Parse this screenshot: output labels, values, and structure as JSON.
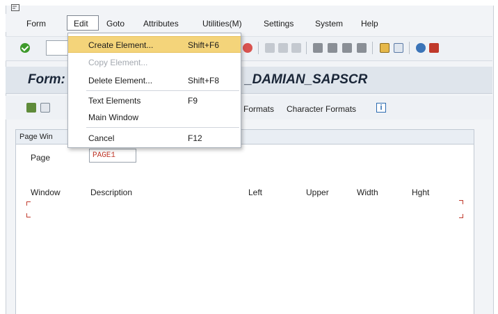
{
  "menubar": {
    "items": [
      "Form",
      "Edit",
      "Goto",
      "Attributes",
      "Utilities(M)",
      "Settings",
      "System",
      "Help"
    ]
  },
  "title": {
    "left": "Form:",
    "right": "_DAMIAN_SAPSCR"
  },
  "app_toolbar": {
    "formats": "Formats",
    "character_formats": "Character Formats"
  },
  "panel": {
    "title": "Page Win",
    "page_label": "Page",
    "page_value": "PAGE1",
    "columns": [
      "Window",
      "Description",
      "Left",
      "Upper",
      "Width",
      "Hght"
    ]
  },
  "dropdown": {
    "items": [
      {
        "label": "Create Element...",
        "shortcut": "Shift+F6",
        "state": "highlighted"
      },
      {
        "label": "Copy Element...",
        "shortcut": "",
        "state": "disabled"
      },
      {
        "label": "Delete Element...",
        "shortcut": "Shift+F8",
        "state": "normal"
      },
      {
        "label": "Text Elements",
        "shortcut": "F9",
        "state": "normal"
      },
      {
        "label": "Main Window",
        "shortcut": "",
        "state": "normal"
      },
      {
        "label": "Cancel",
        "shortcut": "F12",
        "state": "normal"
      }
    ]
  },
  "colors": {
    "highlight": "#f4d47a",
    "title_bar": "#dfe5ec",
    "ok_green": "#3e9a2b",
    "cancel_red": "#d9534f",
    "corner_red": "#c0392b"
  },
  "icons": [
    "menu-icon",
    "ok-icon",
    "cancel-icon",
    "print-icon",
    "find-icon",
    "find-next-icon",
    "first-page-icon",
    "prev-page-icon",
    "next-page-icon",
    "last-page-icon",
    "new-session-icon",
    "layout-icon",
    "help-icon",
    "customize-icon",
    "info-icon"
  ]
}
